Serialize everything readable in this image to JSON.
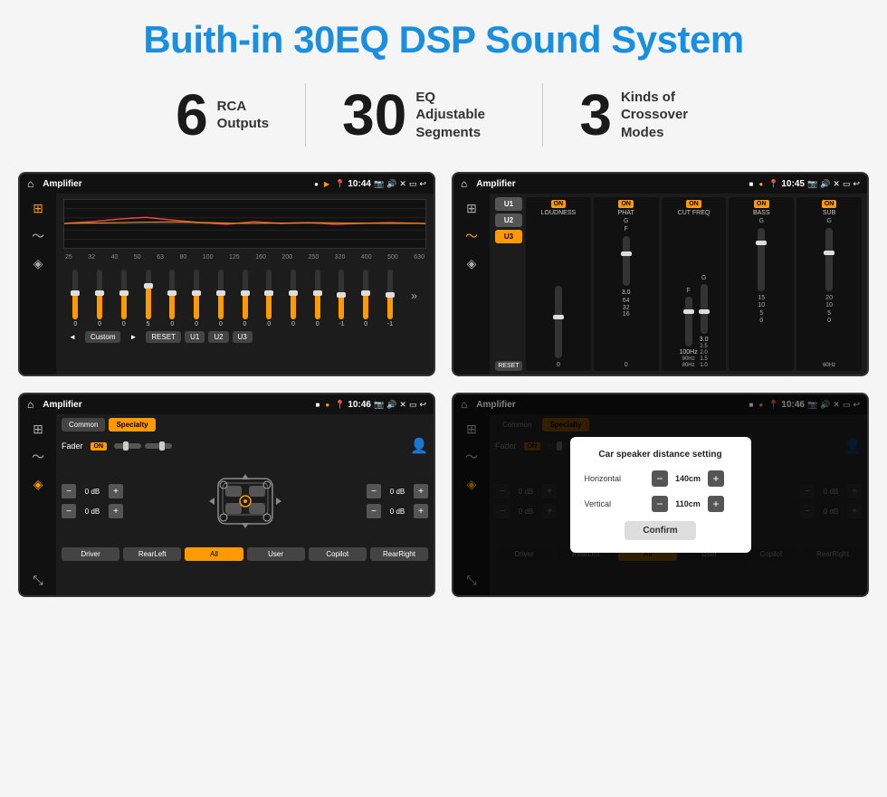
{
  "header": {
    "title": "Buith-in 30EQ DSP Sound System"
  },
  "stats": [
    {
      "number": "6",
      "label": "RCA\nOutputs"
    },
    {
      "number": "30",
      "label": "EQ Adjustable\nSegments"
    },
    {
      "number": "3",
      "label": "Kinds of\nCrossover Modes"
    }
  ],
  "screenshots": {
    "eq_screen": {
      "status": {
        "time": "10:44",
        "title": "Amplifier"
      },
      "frequencies": [
        "25",
        "32",
        "40",
        "50",
        "63",
        "80",
        "100",
        "125",
        "160",
        "200",
        "250",
        "320",
        "400",
        "500",
        "630"
      ],
      "values": [
        "0",
        "0",
        "0",
        "5",
        "0",
        "0",
        "0",
        "0",
        "0",
        "0",
        "0",
        "-1",
        "0",
        "-1"
      ],
      "controls": [
        "◄",
        "Custom",
        "►",
        "RESET",
        "U1",
        "U2",
        "U3"
      ]
    },
    "dsp_screen": {
      "status": {
        "time": "10:45",
        "title": "Amplifier"
      },
      "presets": [
        "U1",
        "U2",
        "U3"
      ],
      "channels": [
        {
          "name": "LOUDNESS",
          "on": true
        },
        {
          "name": "PHAT",
          "on": true
        },
        {
          "name": "CUT FREQ",
          "on": true
        },
        {
          "name": "BASS",
          "on": true
        },
        {
          "name": "SUB",
          "on": true
        }
      ],
      "reset_label": "RESET"
    },
    "fader_screen": {
      "status": {
        "time": "10:46",
        "title": "Amplifier"
      },
      "tabs": [
        "Common",
        "Specialty"
      ],
      "fader_label": "Fader",
      "fader_on": "ON",
      "db_values": [
        "0 dB",
        "0 dB",
        "0 dB",
        "0 dB"
      ],
      "buttons": [
        "Driver",
        "RearLeft",
        "All",
        "User",
        "Copilot",
        "RearRight"
      ]
    },
    "dialog_screen": {
      "status": {
        "time": "10:46",
        "title": "Amplifier"
      },
      "tabs": [
        "Common",
        "Specialty"
      ],
      "dialog": {
        "title": "Car speaker distance setting",
        "horizontal_label": "Horizontal",
        "horizontal_value": "140cm",
        "vertical_label": "Vertical",
        "vertical_value": "110cm",
        "confirm_label": "Confirm"
      },
      "db_values": [
        "0 dB",
        "0 dB"
      ],
      "buttons": [
        "Driver",
        "RearLeft",
        "All",
        "User",
        "Copilot",
        "RearRight"
      ]
    }
  },
  "colors": {
    "accent": "#f90",
    "blue": "#1a8fe0",
    "dark_bg": "#1c1c1c",
    "darker_bg": "#111"
  }
}
